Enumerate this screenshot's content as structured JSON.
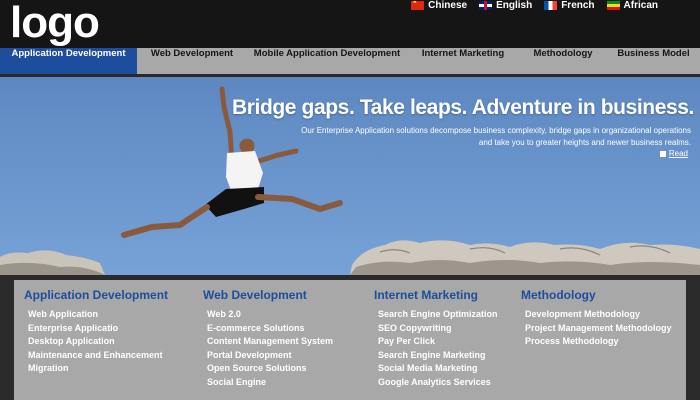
{
  "header": {
    "logo": "logo",
    "languages": [
      {
        "label": "Chinese",
        "flag": "china-flag-icon"
      },
      {
        "label": "English",
        "flag": "uk-flag-icon"
      },
      {
        "label": "French",
        "flag": "france-flag-icon"
      },
      {
        "label": "African",
        "flag": "africa-flag-icon"
      }
    ]
  },
  "nav": {
    "items": [
      {
        "label": "Application Development",
        "active": true
      },
      {
        "label": "Web Development"
      },
      {
        "label": "Mobile Application Development"
      },
      {
        "label": "Internet Marketing"
      },
      {
        "label": "Methodology"
      },
      {
        "label": "Business Model"
      }
    ],
    "active_color": "#1d4d9c"
  },
  "hero": {
    "title": "Bridge gaps. Take leaps. Adventure in business.",
    "text": "Our Enterprise Application solutions decompose business complexity, bridge gaps in organizational operations and take you to greater heights and newer business realms.",
    "read_label": "Read"
  },
  "footer": {
    "columns": [
      {
        "title": "Application Development",
        "items": [
          "Web Application",
          "Enterprise Applicatio",
          "Desktop Application",
          "Maintenance and Enhancement",
          "Migration"
        ]
      },
      {
        "title": "Web Development",
        "items": [
          "Web 2.0",
          "E-commerce Solutions",
          "Content Management System",
          "Portal Development",
          "Open Source Solutions",
          "Social Engine"
        ]
      },
      {
        "title": "Internet Marketing",
        "items": [
          "Search Engine Optimization",
          "SEO Copywriting",
          "Pay Per Click",
          "Search Engine Marketing",
          "Social Media Marketing",
          "Google Analytics Services"
        ]
      },
      {
        "title": "Methodology",
        "items": [
          "Development Methodology",
          "Project Management Methodology",
          "Process Methodology"
        ]
      }
    ],
    "title_color": "#1d4d9c"
  }
}
